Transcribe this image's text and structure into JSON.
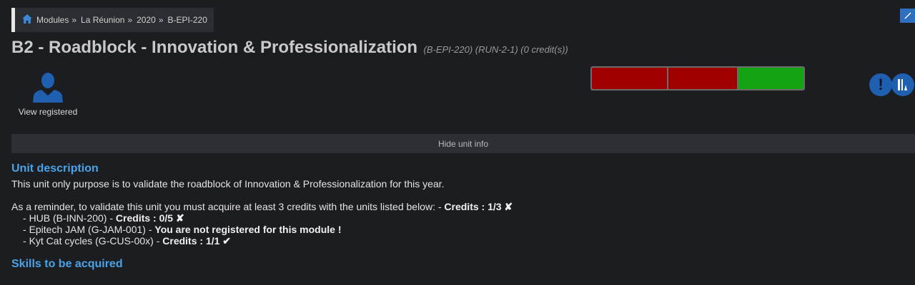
{
  "breadcrumb": {
    "items": [
      "Modules",
      "La Réunion",
      "2020",
      "B-EPI-220"
    ],
    "separator": "»"
  },
  "module": {
    "title": "B2 - Roadblock - Innovation & Professionalization",
    "meta": "(B-EPI-220) (RUN-2-1) (0 credit(s))"
  },
  "registered": {
    "label": "View registered",
    "icon": "user-icon"
  },
  "progress": {
    "segments": [
      {
        "status": "fail",
        "color": "#a10000",
        "fraction": 0.36
      },
      {
        "status": "fail",
        "color": "#a10000",
        "fraction": 0.33
      },
      {
        "status": "pass",
        "color": "#13a313",
        "fraction": 0.31
      }
    ]
  },
  "actions": {
    "alert_icon": "exclamation-icon",
    "alert_symbol": "!",
    "stats_icon": "stats-icon"
  },
  "toggle": {
    "label": "Hide unit info"
  },
  "description": {
    "heading": "Unit description",
    "text": "This unit only purpose is to validate the roadblock of Innovation & Professionalization for this year.",
    "reminder_prefix": "As a reminder, to validate this unit you must acquire at least 3 credits with the units listed below: -  ",
    "reminder_credits": "Credits : 1/3 ✘",
    "units": [
      {
        "name": "HUB (B-INN-200) - ",
        "status": "Credits : 0/5 ✘"
      },
      {
        "name": "Epitech JAM (G-JAM-001) - ",
        "status": "You are not registered for this module !"
      },
      {
        "name": "Kyt Cat cycles (G-CUS-00x) - ",
        "status": "Credits : 1/1 ✔"
      }
    ]
  },
  "skills": {
    "heading": "Skills to be acquired"
  },
  "colors": {
    "accent": "#4aa3e8",
    "button_blue": "#1f5fb0",
    "fail": "#a10000",
    "pass": "#13a313"
  }
}
